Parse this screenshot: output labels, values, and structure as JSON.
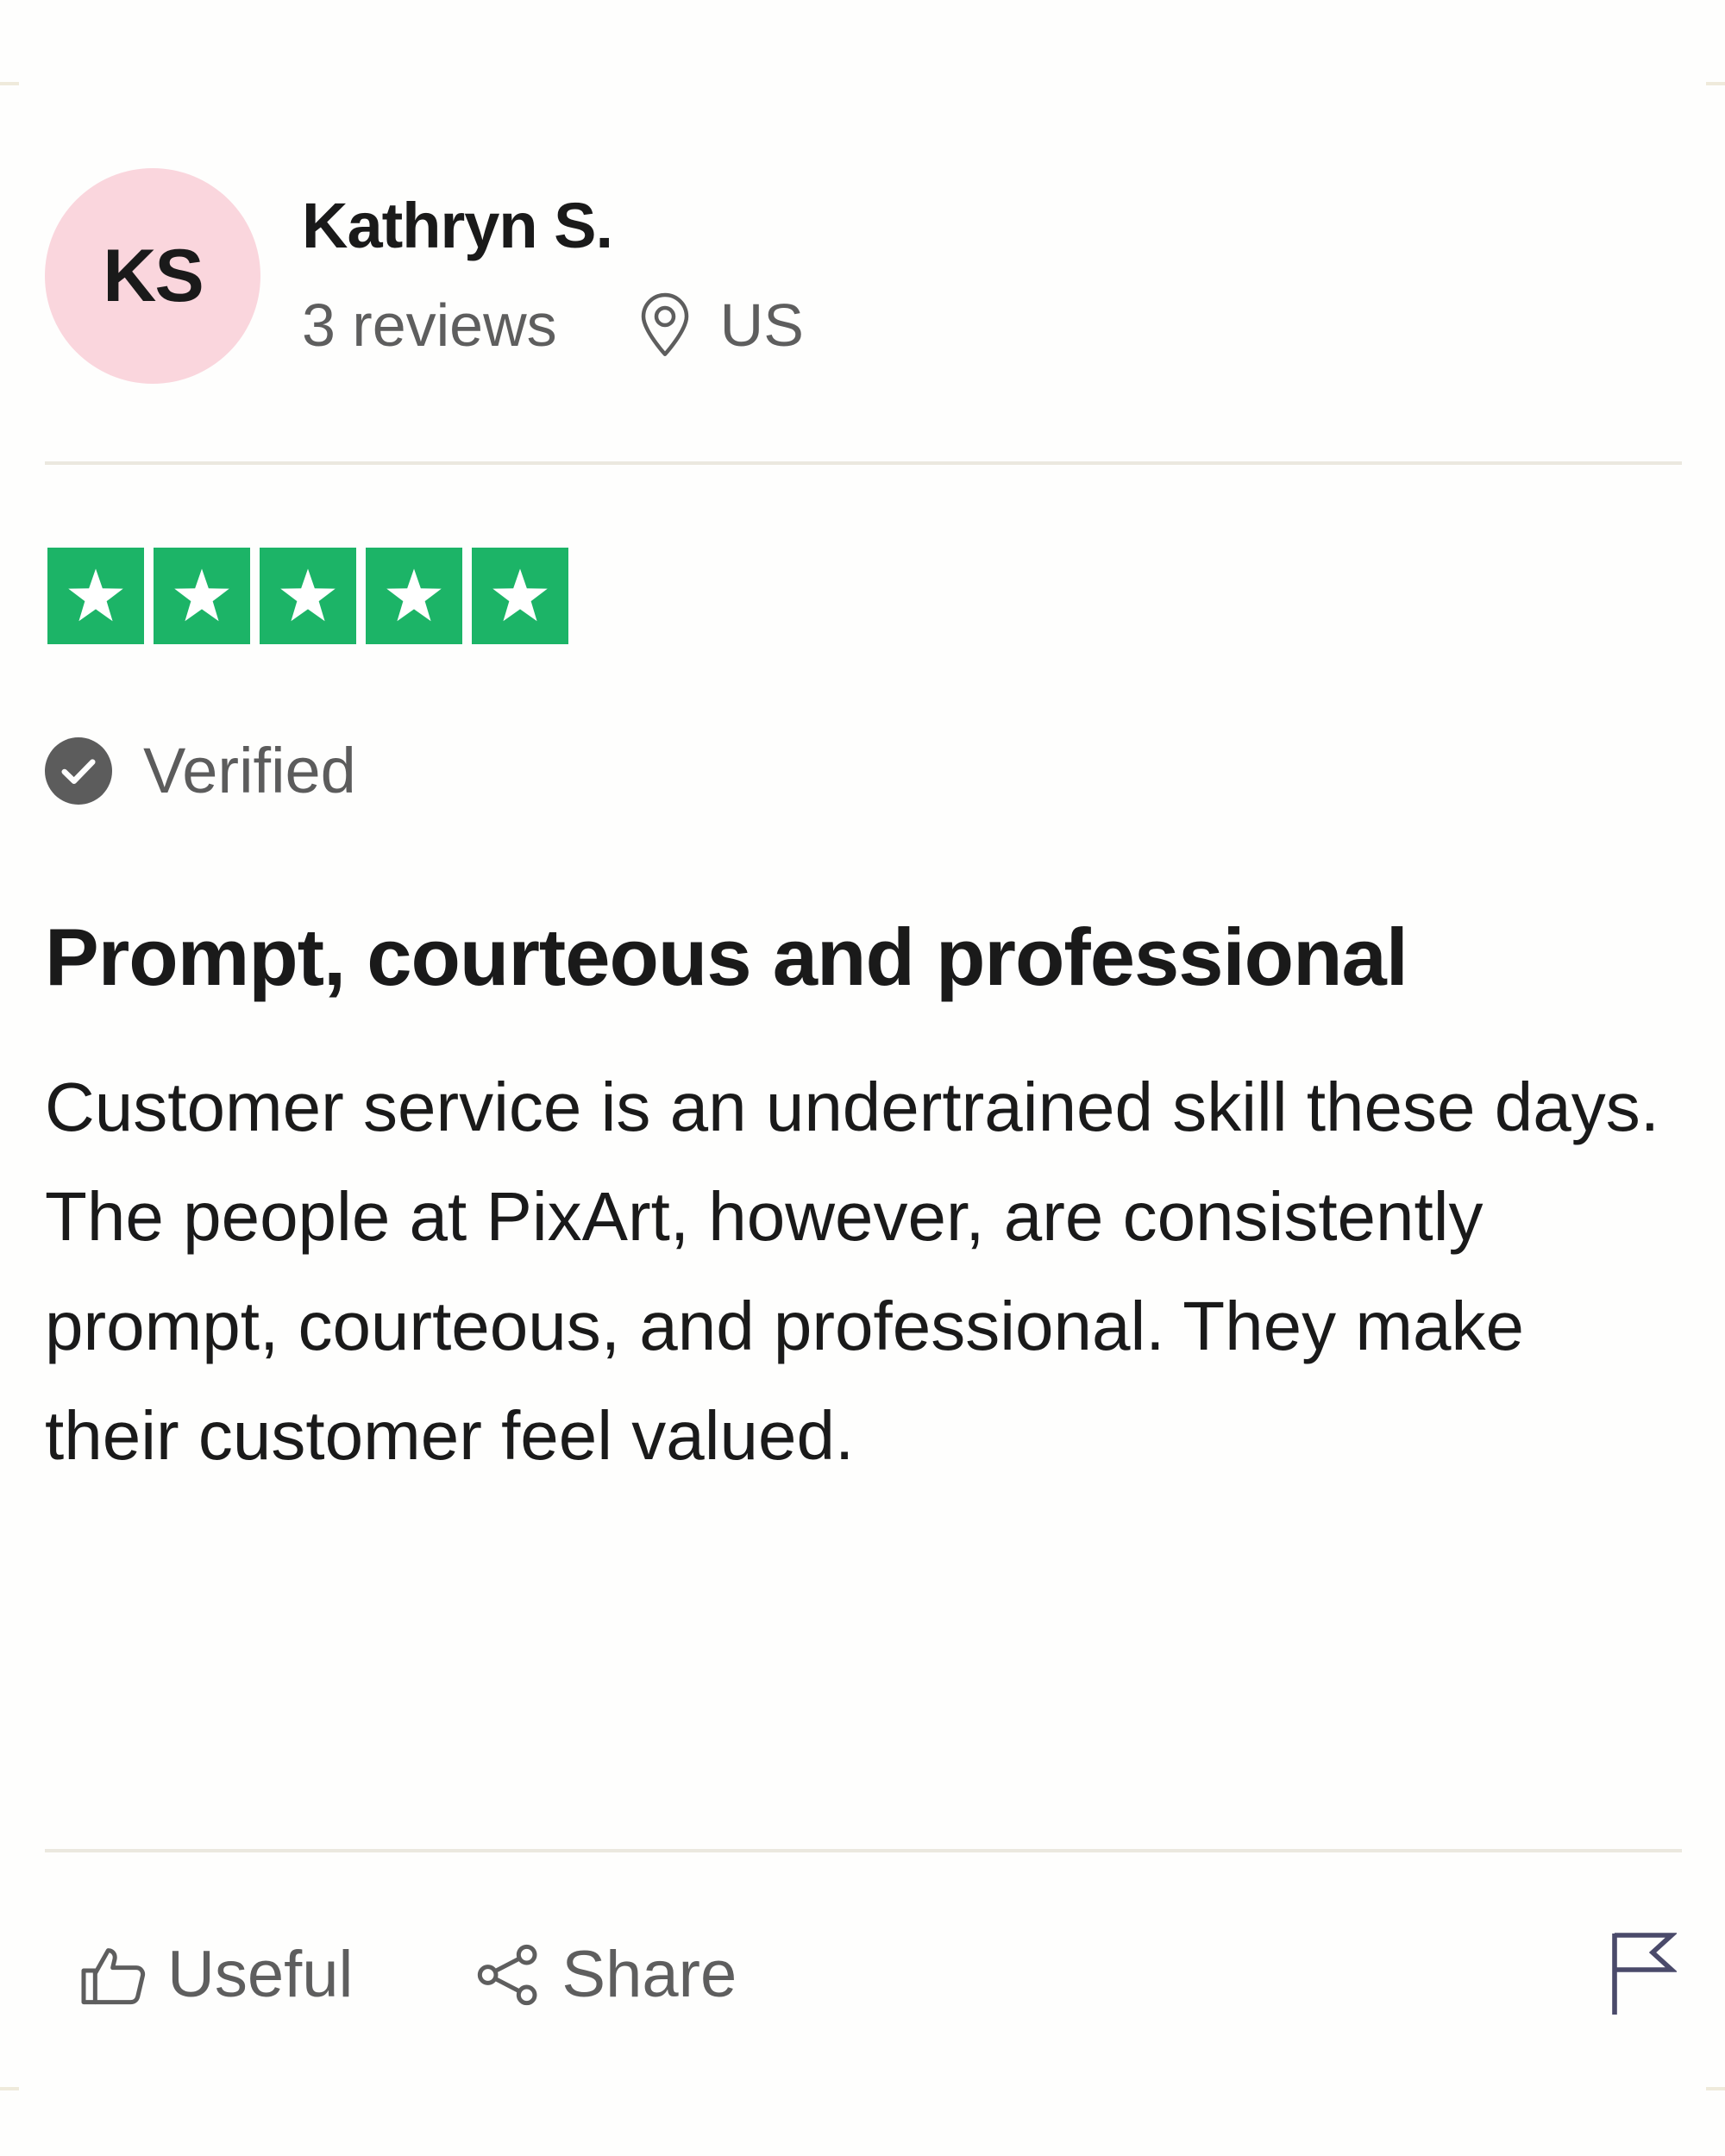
{
  "reviewer": {
    "initials": "KS",
    "name": "Kathryn S.",
    "reviews_count": "3 reviews",
    "location": "US",
    "avatar_color": "#fad6dd"
  },
  "rating": {
    "stars": 5,
    "max_stars": 5,
    "star_color": "#1cb467"
  },
  "verified": {
    "label": "Verified",
    "icon": "check-circle-icon"
  },
  "review": {
    "title": "Prompt, courteous and professional",
    "body": "Customer service is an undertrained skill these days. The people at PixArt, however, are consistently prompt, courteous, and professional. They make their customer feel valued."
  },
  "actions": {
    "useful_label": "Useful",
    "useful_icon": "thumbs-up-icon",
    "share_label": "Share",
    "share_icon": "share-icon",
    "report_icon": "flag-icon"
  }
}
